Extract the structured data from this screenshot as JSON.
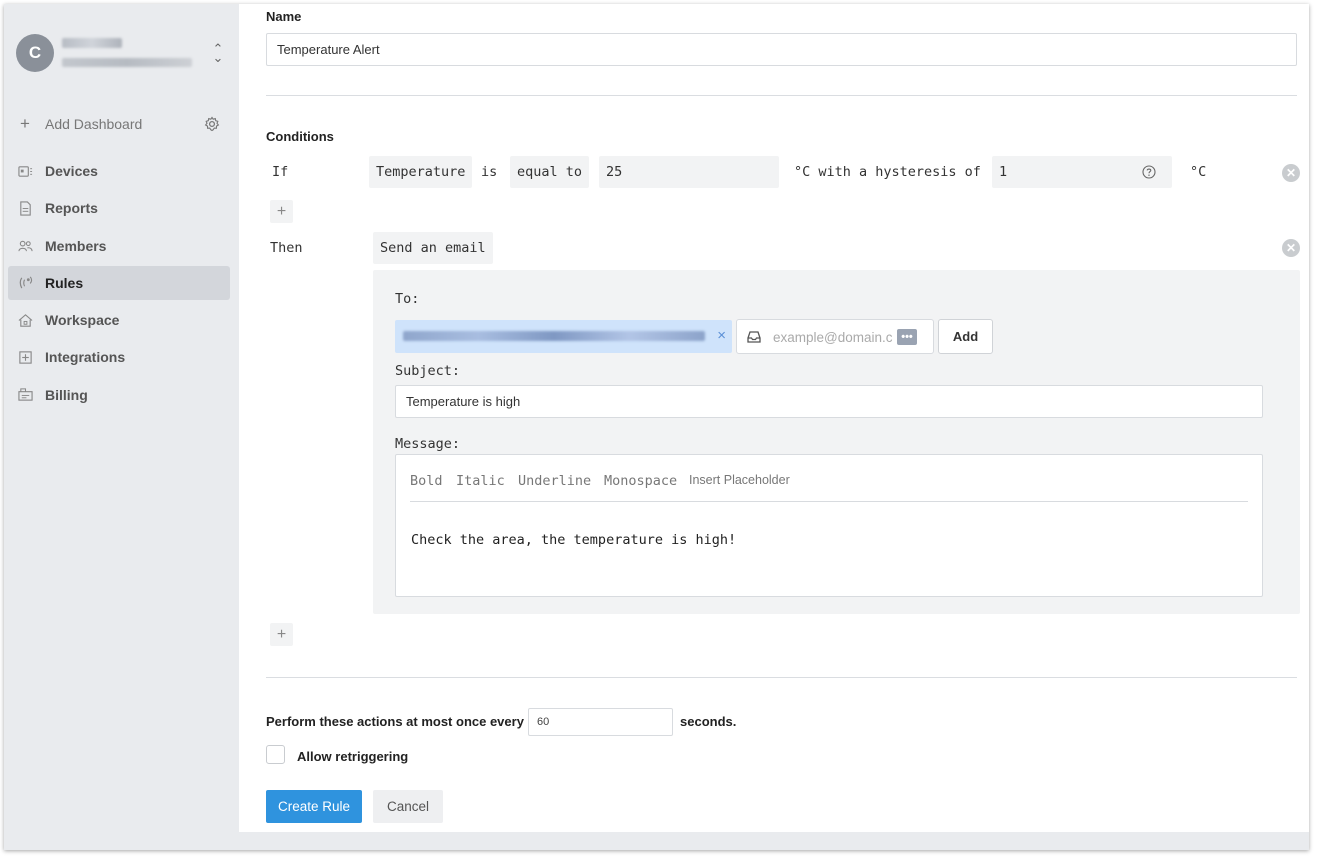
{
  "sidebar": {
    "account": {
      "initial": "C"
    },
    "add_dashboard": "Add Dashboard",
    "items": [
      {
        "label": "Devices",
        "icon": "devices-icon"
      },
      {
        "label": "Reports",
        "icon": "reports-icon"
      },
      {
        "label": "Members",
        "icon": "members-icon"
      },
      {
        "label": "Rules",
        "icon": "rules-icon",
        "active": true
      },
      {
        "label": "Workspace",
        "icon": "workspace-icon"
      },
      {
        "label": "Integrations",
        "icon": "integrations-icon"
      },
      {
        "label": "Billing",
        "icon": "billing-icon"
      }
    ]
  },
  "form": {
    "name_label": "Name",
    "name_value": "Temperature Alert",
    "conditions_label": "Conditions",
    "condition": {
      "if_label": "If",
      "field": "Temperature",
      "is_label": "is",
      "operator": "equal to",
      "value": "25",
      "unit_text": "°C with a hysteresis of",
      "hysteresis": "1",
      "hysteresis_unit": "°C"
    },
    "then_label": "Then",
    "action": {
      "type": "Send an email",
      "to_label": "To:",
      "recipient_placeholder": "example@domain.com",
      "add_label": "Add",
      "subject_label": "Subject:",
      "subject_value": "Temperature is high",
      "message_label": "Message:",
      "toolbar": [
        "Bold",
        "Italic",
        "Underline",
        "Monospace",
        "Insert Placeholder"
      ],
      "message_body": "Check the area, the temperature is high!"
    },
    "throttle": {
      "prefix": "Perform these actions at most once every",
      "value": "60",
      "suffix": "seconds."
    },
    "retrigger_label": "Allow retriggering",
    "retrigger_checked": false,
    "create_label": "Create Rule",
    "cancel_label": "Cancel"
  },
  "colors": {
    "primary": "#2f93de",
    "sidebar_bg": "#e9ebee",
    "active_item": "#d3d6db",
    "recipient_chip": "#cfe3fb"
  }
}
